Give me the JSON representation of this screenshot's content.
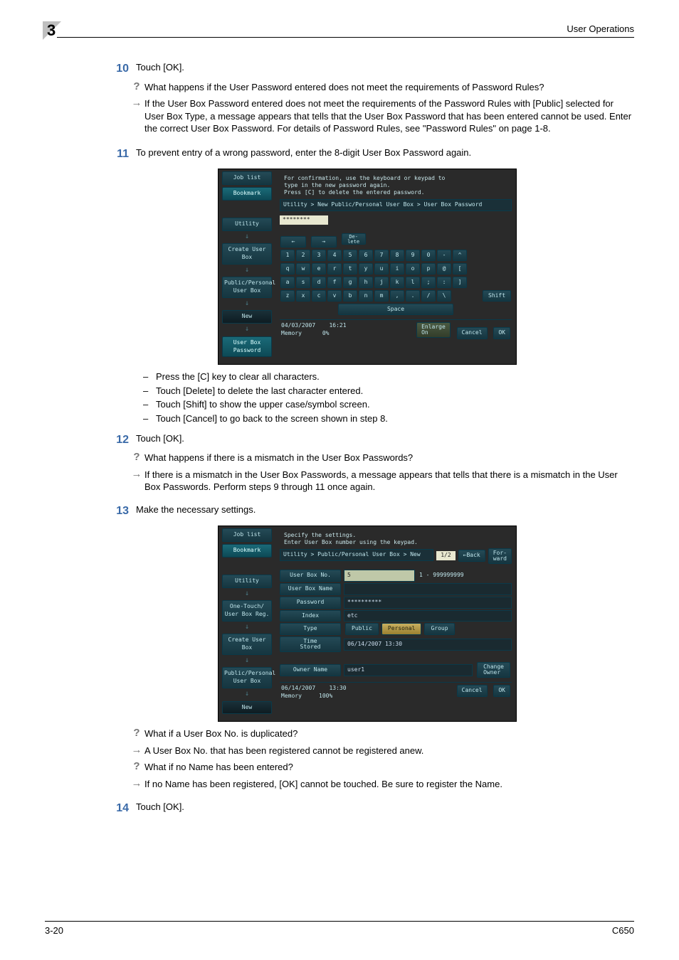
{
  "header": {
    "section_number": "3",
    "title": "User Operations"
  },
  "footer": {
    "page": "3-20",
    "model": "C650"
  },
  "steps": {
    "s10": {
      "num": "10",
      "text": "Touch [OK].",
      "q": "What happens if the User Password entered does not meet the requirements of Password Rules?",
      "a": "If the User Box Password entered does not meet the requirements of the Password Rules with [Public] selected for User Box Type, a message appears that tells that the User Box Password that has been entered cannot be used. Enter the correct User Box Password. For details of Password Rules, see \"Password Rules\" on page 1-8."
    },
    "s11": {
      "num": "11",
      "text": "To prevent entry of a wrong password, enter the 8-digit User Box Password again.",
      "bullets": [
        "Press the [C] key to clear all characters.",
        "Touch [Delete] to delete the last character entered.",
        "Touch [Shift] to show the upper case/symbol screen.",
        "Touch [Cancel] to go back to the screen shown in step 8."
      ]
    },
    "s12": {
      "num": "12",
      "text": "Touch [OK].",
      "q": "What happens if there is a mismatch in the User Box Passwords?",
      "a": "If there is a mismatch in the User Box Passwords, a message appears that tells that there is a mismatch in the User Box Passwords. Perform steps 9 through 11 once again."
    },
    "s13": {
      "num": "13",
      "text": "Make the necessary settings.",
      "q1": "What if a User Box No. is duplicated?",
      "a1": "A User Box No. that has been registered cannot be registered anew.",
      "q2": "What if no Name has been entered?",
      "a2": "If no Name has been registered, [OK] cannot be touched. Be sure to register the Name."
    },
    "s14": {
      "num": "14",
      "text": "Touch [OK]."
    }
  },
  "shot1": {
    "side": {
      "job_list": "Job list",
      "bookmark": "Bookmark",
      "utility": "Utility",
      "create": "Create User Box",
      "pp": "Public/Personal\nUser Box",
      "new": "New",
      "pwd": "User Box\nPassword"
    },
    "msg1": "For confirmation, use the keyboard or keypad to",
    "msg2": "type in the new password again.",
    "msg3": "Press [C] to delete the entered password.",
    "breadcrumb": "Utility > New Public/Personal User Box > User Box Password",
    "value": "********",
    "keys": {
      "arrow_l": "←",
      "arrow_r": "→",
      "delete": "De-\nlete",
      "row1": [
        "1",
        "2",
        "3",
        "4",
        "5",
        "6",
        "7",
        "8",
        "9",
        "0",
        "-",
        "^"
      ],
      "row2": [
        "q",
        "w",
        "e",
        "r",
        "t",
        "y",
        "u",
        "i",
        "o",
        "p",
        "@",
        "["
      ],
      "row3": [
        "a",
        "s",
        "d",
        "f",
        "g",
        "h",
        "j",
        "k",
        "l",
        ";",
        ":",
        "]"
      ],
      "row4": [
        "z",
        "x",
        "c",
        "v",
        "b",
        "n",
        "m",
        ",",
        ".",
        "/",
        "\\"
      ],
      "shift": "Shift",
      "space": "Space"
    },
    "bottom": {
      "date": "04/03/2007",
      "time": "16:21",
      "mem": "Memory",
      "mem_v": "0%",
      "enlarge": "Enlarge\nOn",
      "cancel": "Cancel",
      "ok": "OK"
    }
  },
  "shot2": {
    "side": {
      "job_list": "Job list",
      "bookmark": "Bookmark",
      "utility": "Utility",
      "one_touch": "One-Touch/\nUser Box Reg.",
      "create": "Create User Box",
      "pp": "Public/Personal\nUser Box",
      "new": "New"
    },
    "msg1": "Specify the settings.",
    "msg2": "Enter User Box number using the keypad.",
    "breadcrumb": "Utility > Public/Personal User Box > New",
    "page": "1/2",
    "back": "←Back",
    "fwd": "For-\nward",
    "labels": {
      "no": "User Box No.",
      "name": "User Box Name",
      "pwd": "Password",
      "index": "Index",
      "type": "Type",
      "time": "Time\nStored",
      "owner": "Owner Name"
    },
    "values": {
      "no": "5",
      "range": "1 - 999999999",
      "pwd": "**********",
      "index": "etc",
      "public": "Public",
      "personal": "Personal",
      "group": "Group",
      "time": "06/14/2007  13:30",
      "owner": "user1",
      "change": "Change\nOwner"
    },
    "bottom": {
      "date": "06/14/2007",
      "time": "13:30",
      "mem": "Memory",
      "mem_v": "100%",
      "cancel": "Cancel",
      "ok": "OK"
    }
  }
}
